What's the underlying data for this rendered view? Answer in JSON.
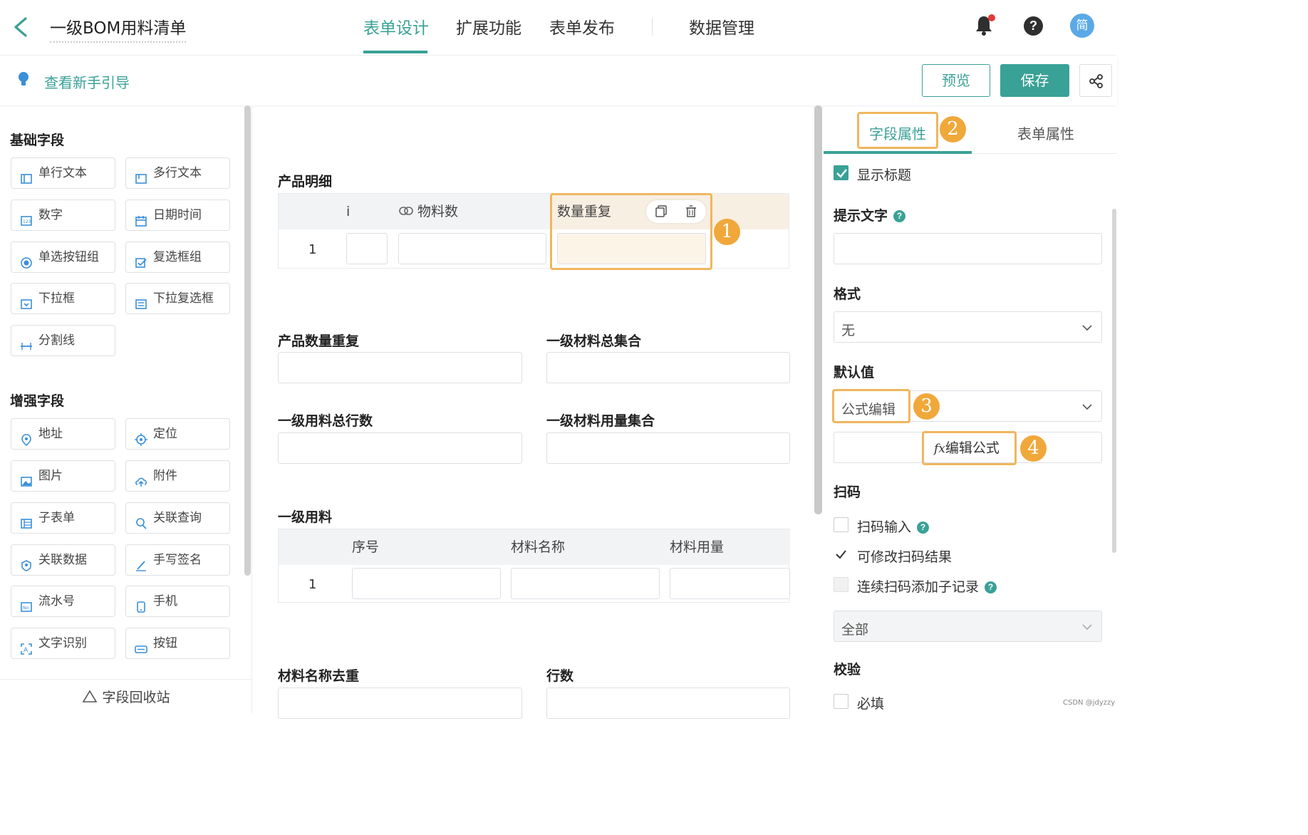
{
  "header": {
    "title": "一级BOM用料清单",
    "tabs": [
      {
        "label": "表单设计",
        "active": true
      },
      {
        "label": "扩展功能",
        "active": false
      },
      {
        "label": "表单发布",
        "active": false
      },
      {
        "label": "数据管理",
        "active": false
      }
    ],
    "avatar_text": "简",
    "help_text": "?",
    "accent_color": "#3aa197",
    "notification_dot_color": "#e53935"
  },
  "toolbar": {
    "guide_link": "查看新手引导",
    "preview_label": "预览",
    "save_label": "保存"
  },
  "left_panel": {
    "basic_title": "基础字段",
    "basic_fields": [
      {
        "label": "单行文本",
        "icon": "single-line-text-icon"
      },
      {
        "label": "多行文本",
        "icon": "multi-line-text-icon"
      },
      {
        "label": "数字",
        "icon": "number-icon"
      },
      {
        "label": "日期时间",
        "icon": "calendar-icon"
      },
      {
        "label": "单选按钮组",
        "icon": "radio-icon"
      },
      {
        "label": "复选框组",
        "icon": "checkbox-group-icon"
      },
      {
        "label": "下拉框",
        "icon": "dropdown-icon"
      },
      {
        "label": "下拉复选框",
        "icon": "dropdown-checkbox-icon"
      },
      {
        "label": "分割线",
        "icon": "divider-icon"
      }
    ],
    "enhanced_title": "增强字段",
    "enhanced_fields": [
      {
        "label": "地址",
        "icon": "location-pin-icon"
      },
      {
        "label": "定位",
        "icon": "crosshair-icon"
      },
      {
        "label": "图片",
        "icon": "image-icon"
      },
      {
        "label": "附件",
        "icon": "upload-cloud-icon"
      },
      {
        "label": "子表单",
        "icon": "subform-icon"
      },
      {
        "label": "关联查询",
        "icon": "link-search-icon"
      },
      {
        "label": "关联数据",
        "icon": "link-data-icon"
      },
      {
        "label": "手写签名",
        "icon": "pen-icon"
      },
      {
        "label": "流水号",
        "icon": "serial-number-icon"
      },
      {
        "label": "手机",
        "icon": "phone-icon"
      },
      {
        "label": "文字识别",
        "icon": "ocr-icon"
      },
      {
        "label": "按钮",
        "icon": "button-icon"
      }
    ],
    "recycle_label": "字段回收站"
  },
  "canvas": {
    "product_detail": {
      "label": "产品明细",
      "col_cut": "i",
      "col_material_count": "物料数",
      "col_qty_repeat": "数量重复",
      "row_index": "1"
    },
    "fields": {
      "product_qty_repeat": "产品数量重复",
      "l1_material_total_set": "一级材料总集合",
      "l1_total_rows": "一级用料总行数",
      "l1_material_qty_set": "一级材料用量集合"
    },
    "l1_material": {
      "label": "一级用料",
      "columns": [
        "序号",
        "材料名称",
        "材料用量"
      ],
      "row_index": "1"
    },
    "bottom_fields": {
      "material_name_dedup": "材料名称去重",
      "row_count": "行数"
    }
  },
  "badges": {
    "b1": "1",
    "b2": "2",
    "b3": "3",
    "b4": "4"
  },
  "right_panel": {
    "tab_field_props": "字段属性",
    "tab_form_props": "表单属性",
    "show_title": "显示标题",
    "hint_text_label": "提示文字",
    "format_label": "格式",
    "format_value": "无",
    "default_value_label": "默认值",
    "default_value_mode": "公式编辑",
    "edit_formula_button": "编辑公式",
    "fx_symbol": "fx",
    "scan_label": "扫码",
    "scan_input": "扫码输入",
    "scan_editable": "可修改扫码结果",
    "scan_continuous": "连续扫码添加子记录",
    "scan_scope": "全部",
    "validation_label": "校验",
    "required": "必填",
    "checks": {
      "show_title": true,
      "scan_input": false,
      "scan_editable": true,
      "scan_continuous": false,
      "required": false
    }
  },
  "watermark": "CSDN @jdyzzy"
}
